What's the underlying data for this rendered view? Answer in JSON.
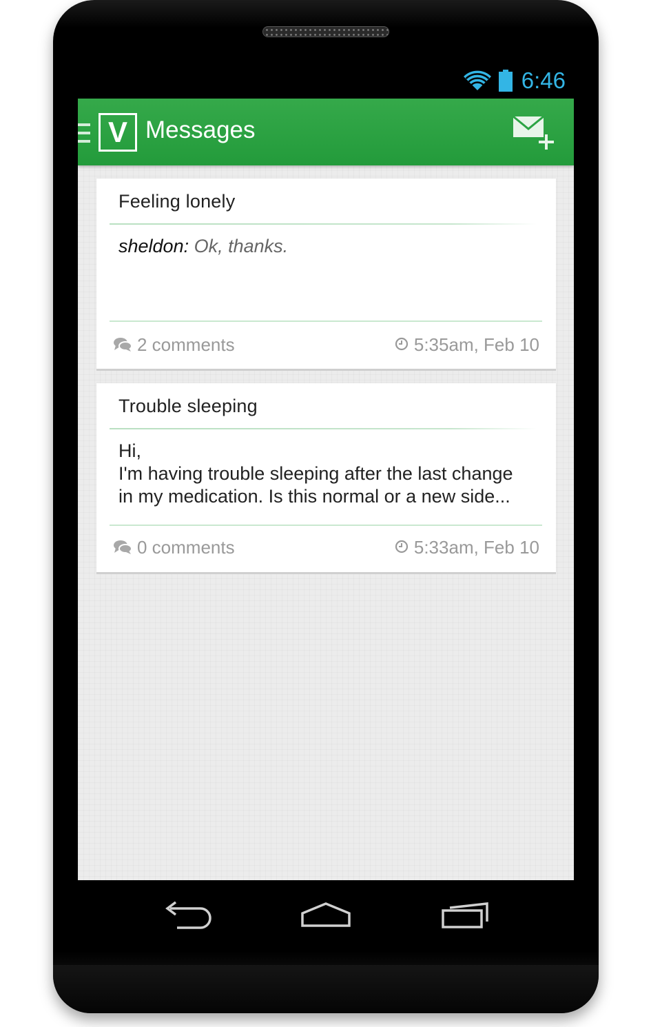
{
  "status_bar": {
    "time": "6:46",
    "icons": [
      "wifi-icon",
      "battery-icon"
    ],
    "time_color": "#33b5e5"
  },
  "action_bar": {
    "logo_letter": "V",
    "title": "Messages",
    "compose_icon": "compose-message-icon",
    "drawer_icon": "drawer-icon",
    "color": "#2ca444"
  },
  "messages": [
    {
      "title": "Feeling lonely",
      "author": "sheldon:",
      "preview": "Ok, thanks.",
      "comments": "2 comments",
      "time": "5:35am, Feb 10"
    },
    {
      "title": "Trouble sleeping",
      "body_lines": [
        "Hi,",
        "I'm having trouble sleeping after the last change",
        "in my medication. Is this normal or a new side..."
      ],
      "comments": "0 comments",
      "time": "5:33am, Feb 10"
    }
  ],
  "nav_bar": {
    "buttons": [
      "back-icon",
      "home-icon",
      "recents-icon"
    ]
  }
}
